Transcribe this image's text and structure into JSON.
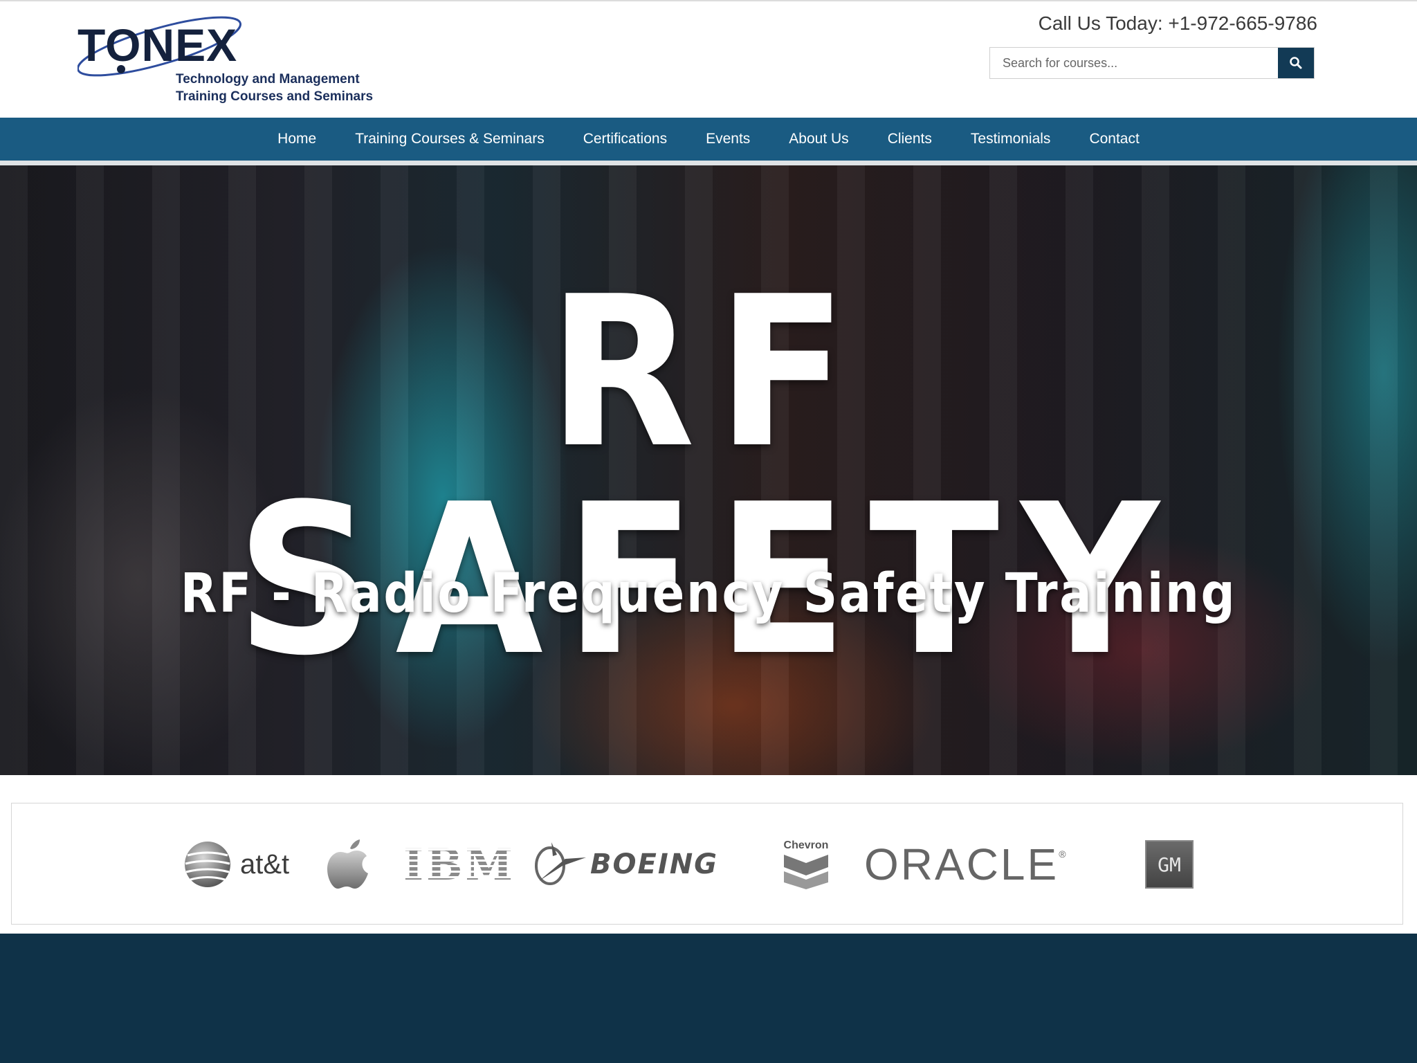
{
  "header": {
    "logo": {
      "wordmark": "TONEX",
      "tagline_line1": "Technology and Management",
      "tagline_line2": "Training Courses and Seminars"
    },
    "phone": "Call Us Today: +1-972-665-9786",
    "search": {
      "placeholder": "Search for courses...",
      "value": "",
      "button_icon": "search-icon"
    }
  },
  "nav": {
    "items": [
      {
        "label": "Home"
      },
      {
        "label": "Training Courses & Seminars"
      },
      {
        "label": "Certifications"
      },
      {
        "label": "Events"
      },
      {
        "label": "About Us"
      },
      {
        "label": "Clients"
      },
      {
        "label": "Testimonials"
      },
      {
        "label": "Contact"
      }
    ]
  },
  "hero": {
    "title": "RF SAFETY",
    "subtitle": "RF - Radio Frequency Safety Training"
  },
  "clients": {
    "logos": [
      {
        "name": "at&t",
        "text": "at&t"
      },
      {
        "name": "apple",
        "text": ""
      },
      {
        "name": "IBM",
        "text": "IBM"
      },
      {
        "name": "Boeing",
        "text": "BOEING"
      },
      {
        "name": "Chevron",
        "text": "Chevron"
      },
      {
        "name": "Oracle",
        "text": "ORACLE"
      },
      {
        "name": "GM",
        "text": "GM"
      }
    ]
  },
  "colors": {
    "nav_bg": "#1a5b82",
    "footer_bg": "#0f3248",
    "search_button": "#123a55",
    "logo_text": "#14213d"
  }
}
